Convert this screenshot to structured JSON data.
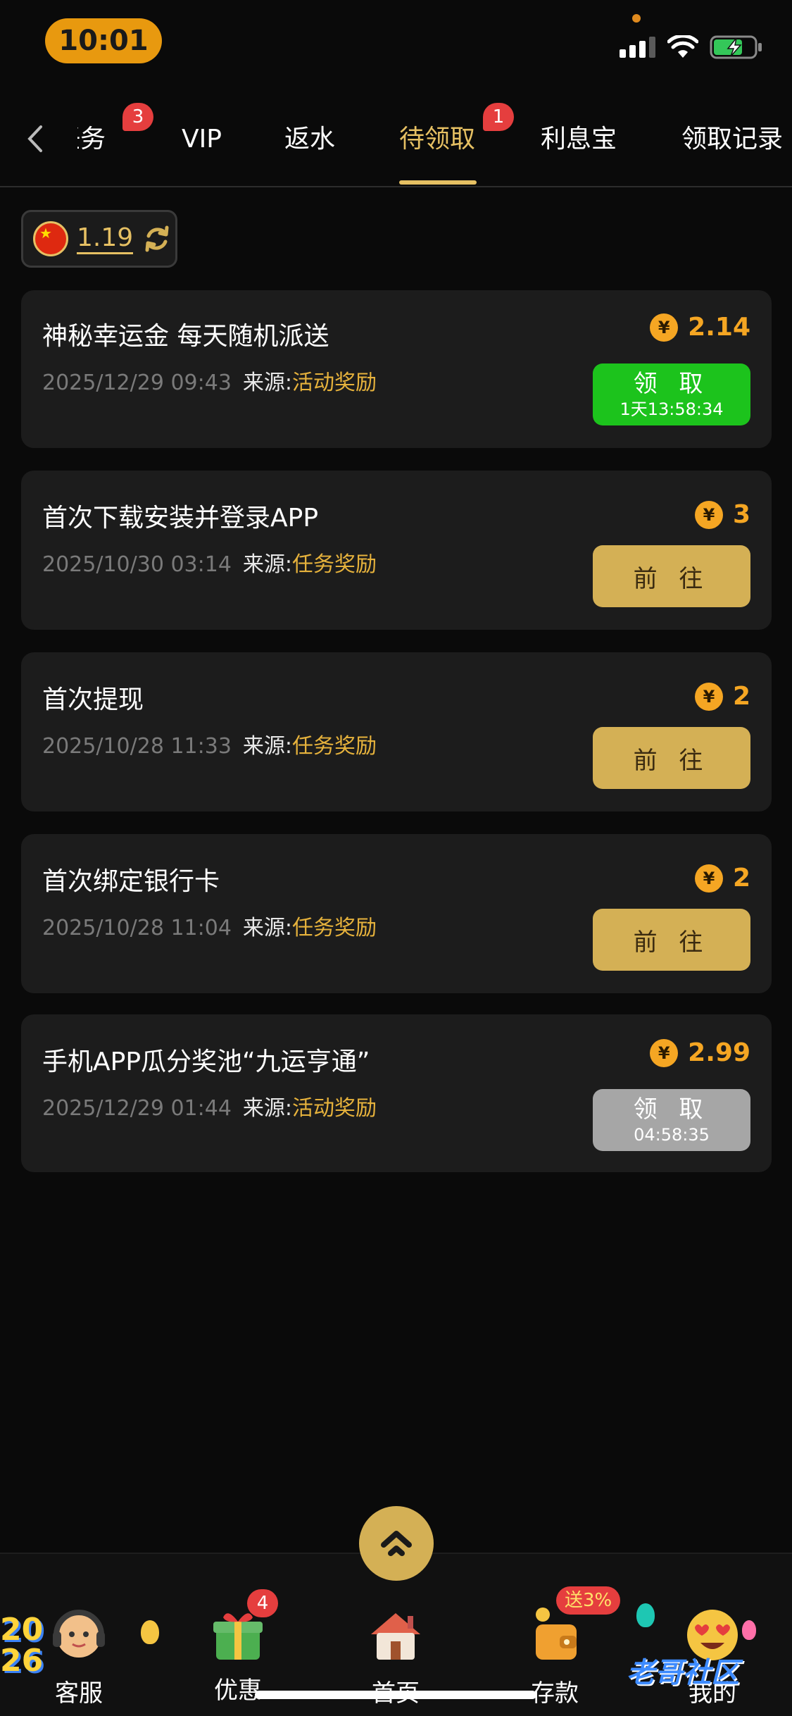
{
  "status_bar": {
    "time": "10:01"
  },
  "tabs": [
    {
      "label": "任务",
      "badge": "3"
    },
    {
      "label": "VIP"
    },
    {
      "label": "返水"
    },
    {
      "label": "待领取",
      "badge": "1",
      "active": true
    },
    {
      "label": "利息宝"
    },
    {
      "label": "领取记录"
    }
  ],
  "balance": {
    "value": "1.19"
  },
  "source_label": "来源:",
  "rewards": [
    {
      "title": "神秘幸运金 每天随机派送",
      "date": "2025/12/29 09:43",
      "source": "活动奖励",
      "amount": "2.14",
      "button": "领 取",
      "countdown": "1天13:58:34",
      "button_style": "green"
    },
    {
      "title": "首次下载安装并登录APP",
      "date": "2025/10/30 03:14",
      "source": "任务奖励",
      "amount": "3",
      "button": "前 往",
      "button_style": "gold"
    },
    {
      "title": "首次提现",
      "date": "2025/10/28 11:33",
      "source": "任务奖励",
      "amount": "2",
      "button": "前 往",
      "button_style": "gold"
    },
    {
      "title": "首次绑定银行卡",
      "date": "2025/10/28 11:04",
      "source": "任务奖励",
      "amount": "2",
      "button": "前 往",
      "button_style": "gold"
    },
    {
      "title": "手机APP瓜分奖池“九运亨通”",
      "date": "2025/12/29 01:44",
      "source": "活动奖励",
      "amount": "2.99",
      "button": "领 取",
      "countdown": "04:58:35",
      "button_style": "gray"
    }
  ],
  "currency_symbol": "¥",
  "bottom_nav": [
    {
      "label": "客服"
    },
    {
      "label": "优惠",
      "badge": "4"
    },
    {
      "label": "首页"
    },
    {
      "label": "存款",
      "promo": "送3%"
    },
    {
      "label": "我的"
    }
  ],
  "decorations": {
    "year": "2026",
    "watermark": "老哥社区"
  },
  "colors": {
    "accent_gold": "#e6c063",
    "amount_orange": "#f5a623",
    "claim_green": "#1cc31c",
    "badge_red": "#e53e3e",
    "background": "#0a0a0a",
    "card": "#1c1c1c"
  }
}
